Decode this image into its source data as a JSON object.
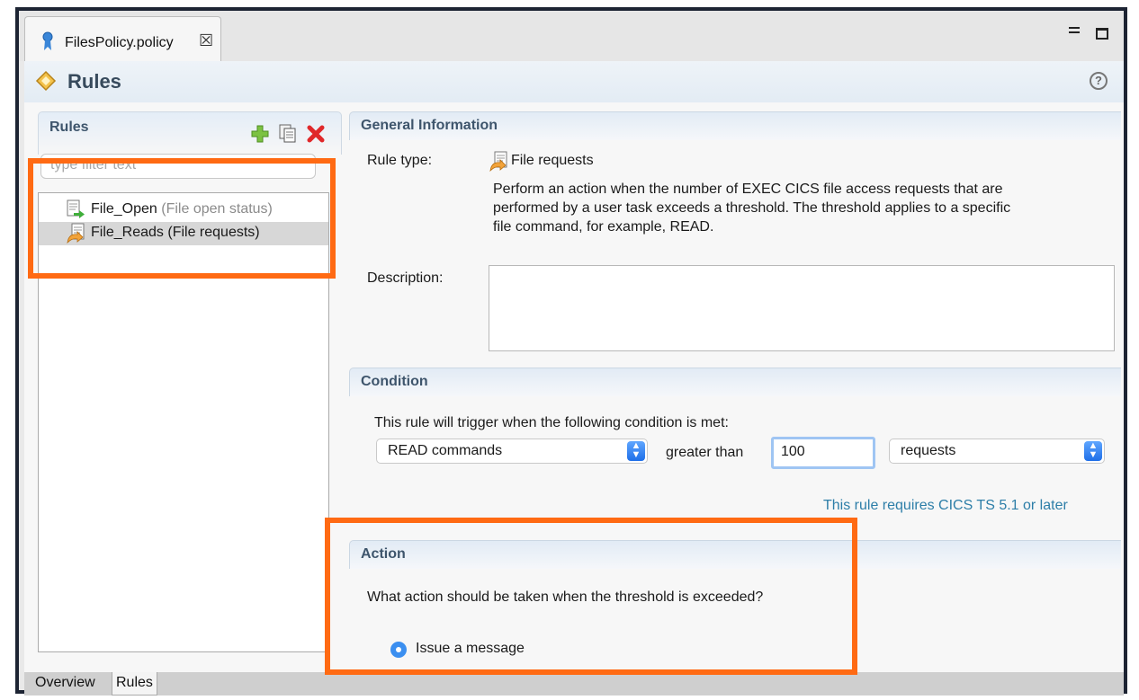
{
  "tab": {
    "title": "FilesPolicy.policy",
    "close_glyph": "☒",
    "icon": "policy-ribbon-icon"
  },
  "header": {
    "title": "Rules",
    "help_glyph": "?"
  },
  "rules_panel": {
    "title": "Rules",
    "filter_placeholder": "type filter text",
    "items": [
      {
        "name": "File_Open",
        "type": " (File open status)",
        "icon": "file-open-icon"
      },
      {
        "name": "File_Reads (File requests)",
        "type": "",
        "icon": "file-requests-icon"
      }
    ],
    "selected_index": 1
  },
  "general": {
    "title": "General Information",
    "rule_type_label": "Rule type:",
    "rule_type_value": "File requests",
    "explanation_line1": "Perform an action when the number of EXEC CICS file access requests that are",
    "explanation_line2": "performed by a user task exceeds a threshold. The threshold applies to a specific",
    "explanation_line3": "file command, for example, READ.",
    "description_label": "Description:",
    "description_value": ""
  },
  "condition": {
    "title": "Condition",
    "intro": "This rule will trigger when the following condition is met:",
    "command_select": "READ commands",
    "operator": "greater than",
    "threshold_value": "100",
    "unit_select": "requests",
    "requirement_link": "This rule requires CICS TS 5.1 or later"
  },
  "action": {
    "title": "Action",
    "question": "What action should be taken when the threshold is exceeded?",
    "option_label": "Issue a message",
    "option_selected": true
  },
  "bottom_tabs": {
    "overview": "Overview",
    "rules": "Rules",
    "active": "Rules"
  },
  "colors": {
    "highlight": "#ff6a13",
    "accent": "#3b8ff0",
    "link": "#2d7ea8",
    "section_title": "#3e556c"
  }
}
